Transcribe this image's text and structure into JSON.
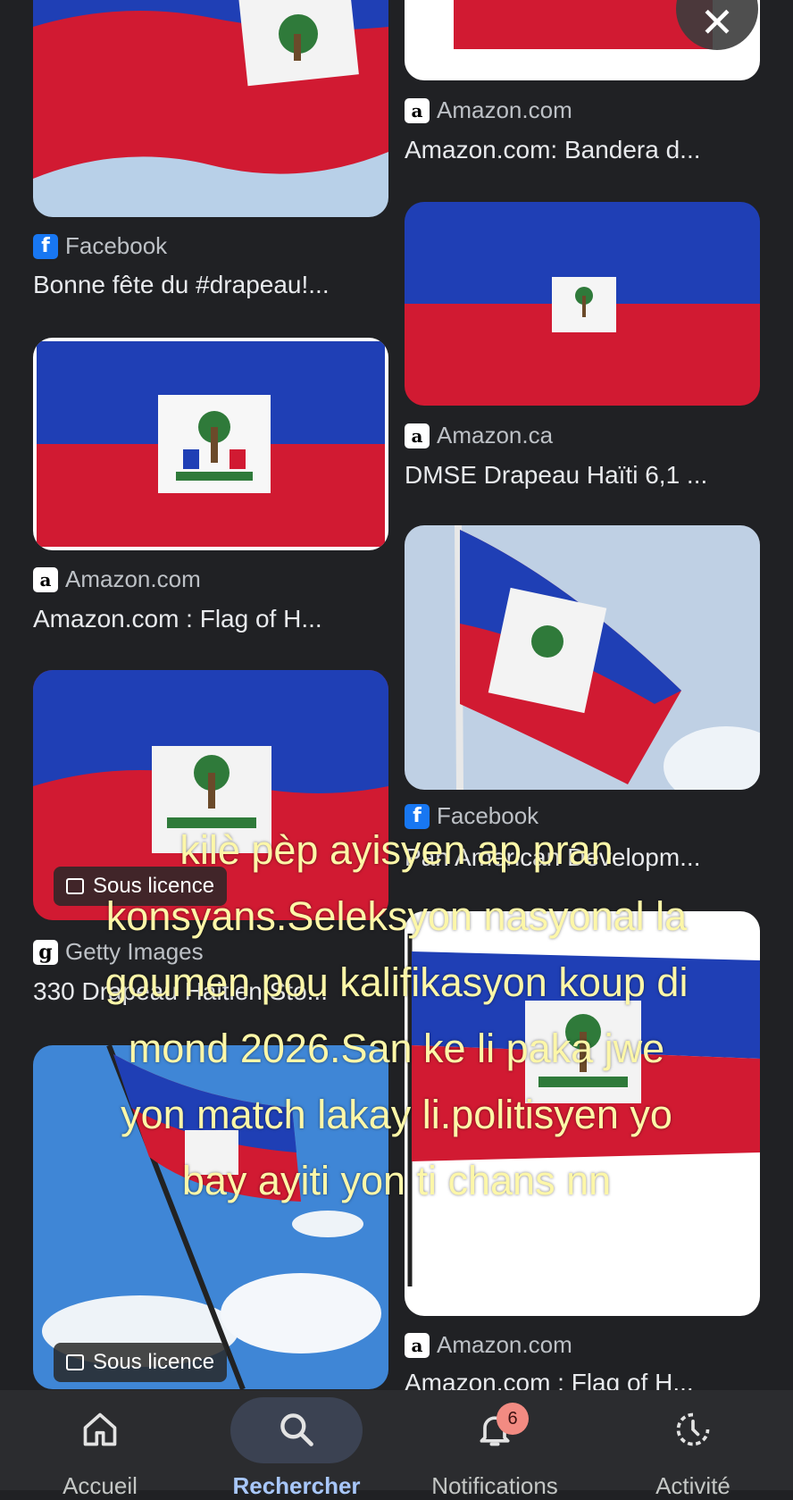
{
  "results": [
    {
      "source": "Facebook",
      "source_icon": "facebook-icon",
      "title": "Bonne fête du #drapeau!..."
    },
    {
      "source": "Amazon.com",
      "source_icon": "amazon-icon",
      "title": "Amazon.com: Bandera d..."
    },
    {
      "source": "Amazon.ca",
      "source_icon": "amazon-icon",
      "title": "DMSE Drapeau Haïti 6,1 ..."
    },
    {
      "source": "Amazon.com",
      "source_icon": "amazon-icon",
      "title": "Amazon.com : Flag of H..."
    },
    {
      "source": "Facebook",
      "source_icon": "facebook-icon",
      "title": "Pan American Developm..."
    },
    {
      "source": "Getty Images",
      "source_icon": "getty-icon",
      "title": "330 Drapeau Haitien Sto..."
    },
    {
      "source": "Amazon.com",
      "source_icon": "amazon-icon",
      "title": "Amazon.com : Flag of H..."
    }
  ],
  "badges": {
    "licence": "Sous licence"
  },
  "overlay": {
    "lines": [
      "kilè pèp ayisyen ap pran",
      "konsyans.Seleksyon nasyonal la",
      "goumen pou kalifikasyon koup di",
      "mond 2026.San ke li paka jwe",
      "yon match lakay li.politisyen yo",
      "bay ayiti yon ti chans nn"
    ]
  },
  "nav": {
    "home": "Accueil",
    "search": "Rechercher",
    "notifications": "Notifications",
    "notifications_count": "6",
    "activity": "Activité"
  },
  "colors": {
    "flag_blue": "#1f3fb5",
    "flag_red": "#d11a32",
    "overlay_text": "#fdf7a8",
    "nav_active": "#a8c7fa"
  }
}
